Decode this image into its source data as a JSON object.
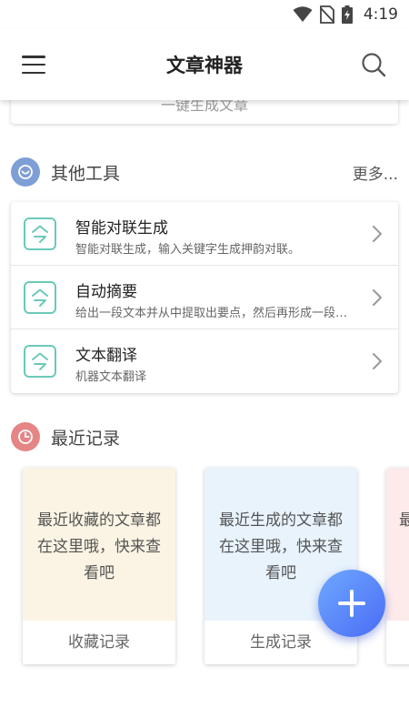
{
  "status_bar": {
    "time": "4:19"
  },
  "app_bar": {
    "title": "文章神器"
  },
  "prev_card": {
    "text": "一键生成文章"
  },
  "tools_section": {
    "title": "其他工具",
    "more": "更多...",
    "items": [
      {
        "name": "智能对联生成",
        "desc": "智能对联生成，输入关键字生成押韵对联。"
      },
      {
        "name": "自动摘要",
        "desc": "给出一段文本并从中提取出要点，然后再形成一段简短的摘要"
      },
      {
        "name": "文本翻译",
        "desc": "机器文本翻译"
      }
    ]
  },
  "records_section": {
    "title": "最近记录",
    "cards": [
      {
        "text": "最近收藏的文章都在这里哦，快来查看吧",
        "footer": "收藏记录",
        "bg": "#fbf4e4"
      },
      {
        "text": "最近生成的文章都在这里哦，快来查看吧",
        "footer": "生成记录",
        "bg": "#e8f3fc"
      },
      {
        "text": "最近",
        "footer": "",
        "bg": "#fdeaea"
      }
    ]
  },
  "colors": {
    "tools_icon": "#7e9fd6",
    "records_icon": "#e58585",
    "tool_icon_accent": "#6cc9b8",
    "fab_start": "#6fa8ff",
    "fab_end": "#4a6cf5"
  },
  "icons": {
    "menu": "menu-icon",
    "search": "search-icon",
    "tools": "smile-circle-icon",
    "records": "clock-circle-icon",
    "tool_item": "swap-icon",
    "chevron": "chevron-right-icon",
    "fab": "plus-icon"
  }
}
